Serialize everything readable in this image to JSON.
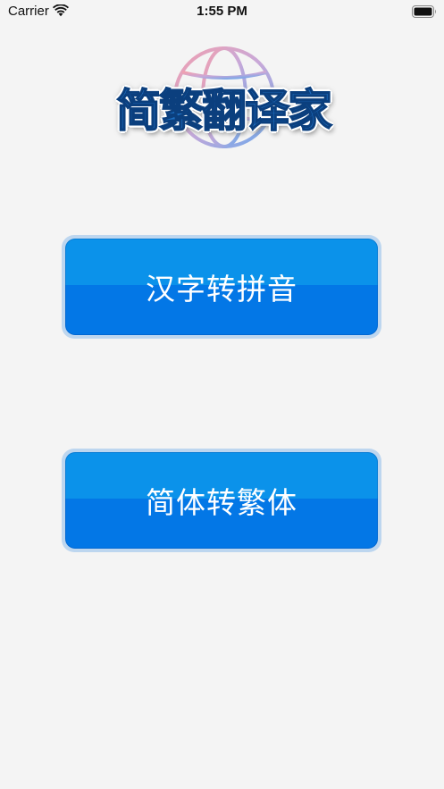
{
  "status_bar": {
    "carrier": "Carrier",
    "time": "1:55 PM",
    "wifi_icon": "wifi-icon",
    "battery_icon": "battery-icon"
  },
  "logo": {
    "text": "简繁翻译家",
    "icon": "globe-icon",
    "text_color": "#1e6fc2"
  },
  "buttons": [
    {
      "label": "汉字转拼音",
      "color": "#0b92ea"
    },
    {
      "label": "简体转繁体",
      "color": "#0377e6"
    }
  ],
  "colors": {
    "background": "#f4f4f4",
    "button_top": "#0b92ea",
    "button_bottom": "#0377e6",
    "button_border": "#bdd6ef"
  }
}
